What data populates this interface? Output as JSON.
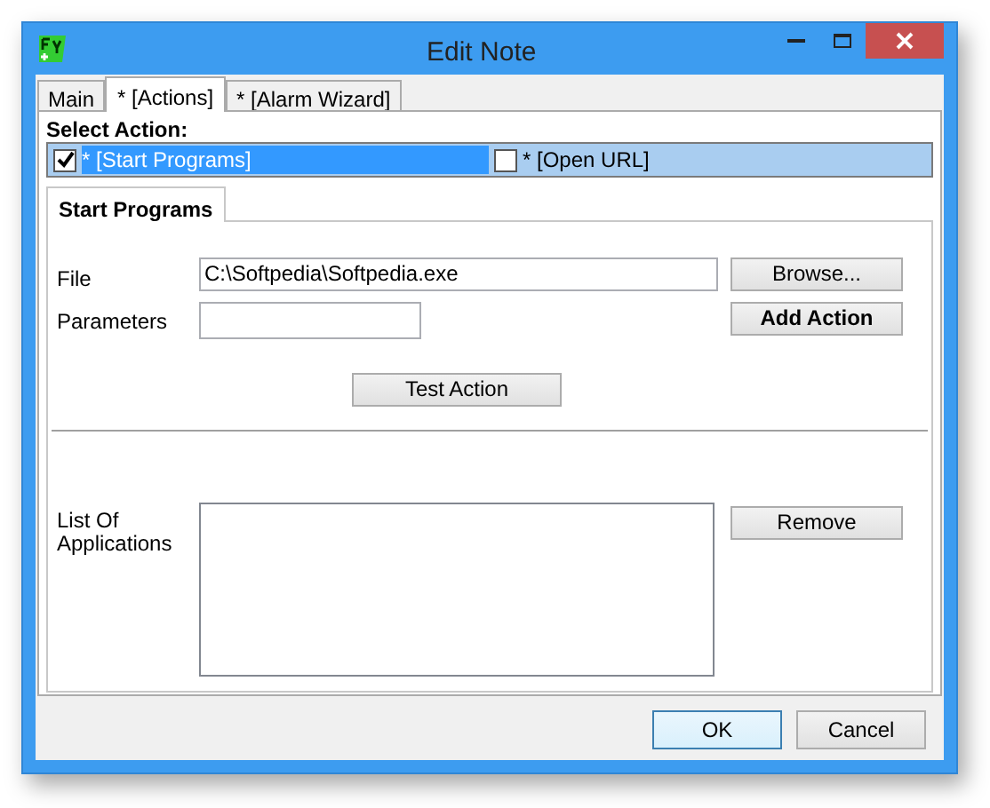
{
  "window": {
    "title": "Edit Note"
  },
  "tabs": [
    {
      "label": "Main",
      "selected": false
    },
    {
      "label": "* [Actions]",
      "selected": true
    },
    {
      "label": "* [Alarm Wizard]",
      "selected": false
    }
  ],
  "select_action": {
    "label": "Select Action:",
    "items": [
      {
        "label": "* [Start Programs]",
        "checked": true,
        "selected": true
      },
      {
        "label": "* [Open URL]",
        "checked": false,
        "selected": false
      }
    ]
  },
  "inner_tabs": [
    {
      "label": "Start Programs",
      "selected": true
    }
  ],
  "form": {
    "file": {
      "label": "File",
      "value": "C:\\Softpedia\\Softpedia.exe"
    },
    "parameters": {
      "label": "Parameters"
    },
    "browse_button": "Browse...",
    "add_action_button": "Add Action",
    "test_action_button": "Test Action",
    "list": {
      "label": "List Of Applications"
    },
    "remove_button": "Remove"
  },
  "buttons": [
    {
      "label": "OK",
      "default": true
    },
    {
      "label": "Cancel",
      "default": false
    }
  ]
}
